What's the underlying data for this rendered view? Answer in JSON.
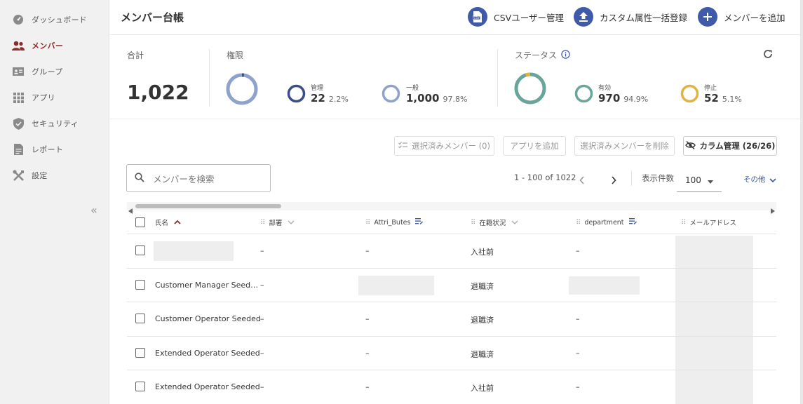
{
  "sidebar": {
    "items": [
      {
        "label": "ダッシュボード",
        "icon": "dashboard-icon"
      },
      {
        "label": "メンバー",
        "icon": "people-icon"
      },
      {
        "label": "グループ",
        "icon": "group-icon"
      },
      {
        "label": "アプリ",
        "icon": "apps-grid-icon"
      },
      {
        "label": "セキュリティ",
        "icon": "shield-icon"
      },
      {
        "label": "レポート",
        "icon": "report-icon"
      },
      {
        "label": "設定",
        "icon": "tools-icon"
      }
    ],
    "active_index": 1,
    "collapse_glyph": "«"
  },
  "header": {
    "title": "メンバー台帳",
    "csv_label": "CSVユーザー管理",
    "bulk_label": "カスタム属性一括登録",
    "add_label": "メンバーを追加"
  },
  "summary": {
    "total_label": "合計",
    "total_value": "1,022",
    "role_label": "権限",
    "admin": {
      "label": "管理",
      "count": "22",
      "pct": "2.2%"
    },
    "general": {
      "label": "一般",
      "count": "1,000",
      "pct": "97.8%"
    },
    "status_label": "ステータス",
    "active": {
      "label": "有効",
      "count": "970",
      "pct": "94.9%"
    },
    "stopped": {
      "label": "停止",
      "count": "52",
      "pct": "5.1%"
    }
  },
  "colors": {
    "accent": "#3f5aa8",
    "admin": "#3b4e86",
    "general": "#8fa2cc",
    "active": "#6aa59c",
    "stopped": "#e2b43f",
    "nav_active": "#8b2b2b"
  },
  "toolbar": {
    "selected_members": "選択済みメンバー (0)",
    "add_app": "アプリを追加",
    "delete_selected": "選択済みメンバーを削除",
    "column_manage": "カラム管理 (26/26)"
  },
  "search": {
    "placeholder": "メンバーを検索"
  },
  "pagination": {
    "range": "1 - 100 of 1022",
    "per_page_label": "表示件数",
    "per_page_value": "100",
    "more_label": "その他"
  },
  "table": {
    "headers": [
      "氏名",
      "部署",
      "Attri_Butes",
      "在籍状況",
      "department",
      "メールアドレス"
    ],
    "rows": [
      {
        "name": "",
        "dept": "–",
        "attr": "–",
        "status": "入社前",
        "department": "–"
      },
      {
        "name": "Customer Manager Seed…",
        "dept": "–",
        "attr": "",
        "status": "退職済",
        "department": ""
      },
      {
        "name": "Customer Operator Seeded",
        "dept": "–",
        "attr": "–",
        "status": "退職済",
        "department": "–"
      },
      {
        "name": "Extended Operator Seeded",
        "dept": "–",
        "attr": "–",
        "status": "退職済",
        "department": "–"
      },
      {
        "name": "Extended Operator Seeded",
        "dept": "–",
        "attr": "–",
        "status": "入社前",
        "department": "–"
      }
    ]
  }
}
